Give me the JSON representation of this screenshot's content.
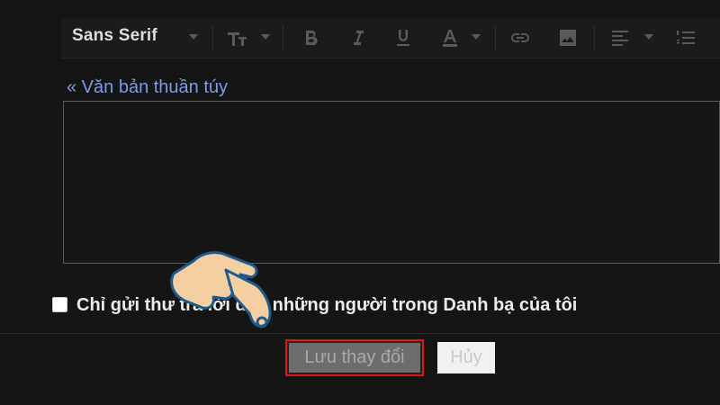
{
  "toolbar": {
    "font_name": "Sans Serif",
    "icons": [
      "text-size-icon",
      "bold-icon",
      "italic-icon",
      "underline-icon",
      "text-color-icon",
      "link-icon",
      "image-icon",
      "align-icon",
      "numbered-list-icon"
    ]
  },
  "editor": {
    "plain_text_link": "« Văn bản thuần túy",
    "content": ""
  },
  "option": {
    "label": "Chỉ gửi thư trả lời đến những người trong Danh bạ của tôi",
    "checked": false
  },
  "actions": {
    "save_label": "Lưu thay đổi",
    "cancel_label": "Hủy"
  },
  "colors": {
    "background": "#151515",
    "link": "#7d9ce8",
    "highlight": "#e1141e",
    "hand_fill": "#f4cfa2",
    "hand_outline": "#1e5a8c"
  }
}
